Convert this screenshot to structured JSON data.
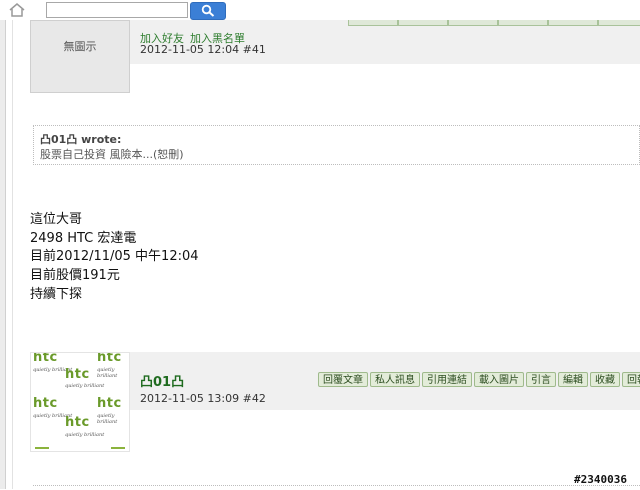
{
  "topbar": {
    "search_placeholder": ""
  },
  "post41": {
    "avatar_text": "無圖示",
    "add_friend": "加入好友",
    "add_blacklist": "加入黑名單",
    "meta": "2012-11-05 12:04 #41",
    "quote_author": "凸01凸 wrote:",
    "quote_text": "股票自己投資 風險本...(恕刪)",
    "body": [
      "這位大哥",
      "2498 HTC 宏達電",
      "目前2012/11/05 中午12:04",
      "目前股價191元",
      "持續下探"
    ]
  },
  "post42": {
    "username": "凸01凸",
    "meta": "2012-11-05 13:09 #42",
    "avatar_logo": "htc",
    "avatar_tagline": "quietly brilliant",
    "buttons": [
      "回覆文章",
      "私人訊息",
      "引用連結",
      "載入圖片",
      "引言",
      "編輯",
      "收藏",
      "回報"
    ]
  },
  "watermark": "#2340036",
  "colors": {
    "accent_green": "#2e7d2e",
    "button_bg": "#e3ecd9",
    "search_button": "#3b7fd6"
  }
}
